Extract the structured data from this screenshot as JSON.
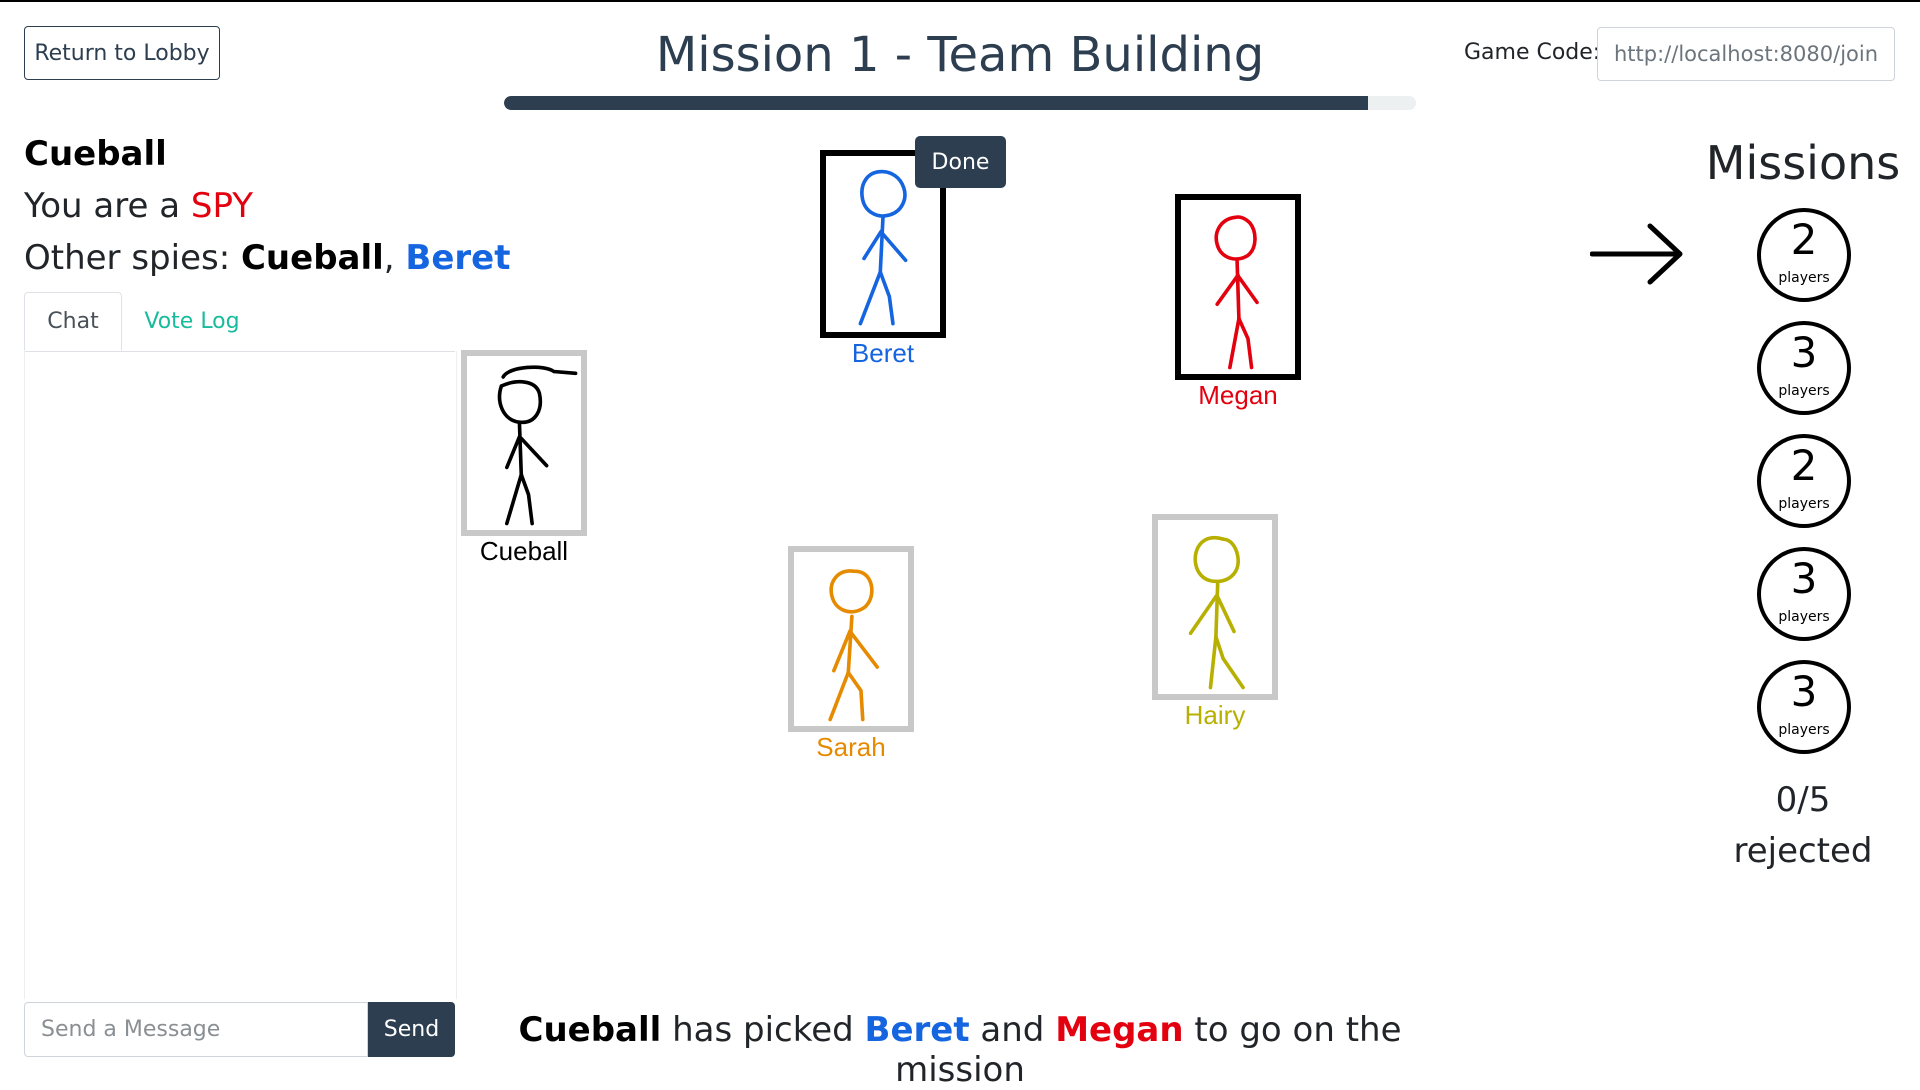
{
  "header": {
    "return_button": "Return to Lobby",
    "title": "Mission 1 - Team Building",
    "progress_fraction": 0.947,
    "game_code_label": "Game Code:",
    "game_code_value": "http://localhost:8080/join/"
  },
  "info": {
    "player_name": "Cueball",
    "role_prefix": "You are a ",
    "role": "SPY",
    "other_spies_label": "Other spies: ",
    "spy1": "Cueball",
    "separator": ", ",
    "spy2": "Beret"
  },
  "tabs": {
    "chat": "Chat",
    "vote_log": "Vote Log"
  },
  "chat": {
    "placeholder": "Send a Message",
    "send": "Send"
  },
  "players": [
    {
      "name": "Beret",
      "color": "#1565e0",
      "selected": true
    },
    {
      "name": "Megan",
      "color": "#e3000f",
      "selected": true
    },
    {
      "name": "Cueball",
      "color": "#000000",
      "selected": false,
      "hat": true
    },
    {
      "name": "Sarah",
      "color": "#e68a00",
      "selected": false
    },
    {
      "name": "Hairy",
      "color": "#b8b000",
      "selected": false
    }
  ],
  "done_button": "Done",
  "status": {
    "leader": "Cueball",
    "picked_text": " has picked ",
    "pick1": "Beret",
    "and_text": " and ",
    "pick2": "Megan",
    "suffix": " to go on the mission"
  },
  "missions": {
    "title": "Missions",
    "current_index": 0,
    "list": [
      {
        "players": "2",
        "label": "players"
      },
      {
        "players": "3",
        "label": "players"
      },
      {
        "players": "2",
        "label": "players"
      },
      {
        "players": "3",
        "label": "players"
      },
      {
        "players": "3",
        "label": "players"
      }
    ],
    "rejected_count": "0/5",
    "rejected_label": "rejected"
  }
}
